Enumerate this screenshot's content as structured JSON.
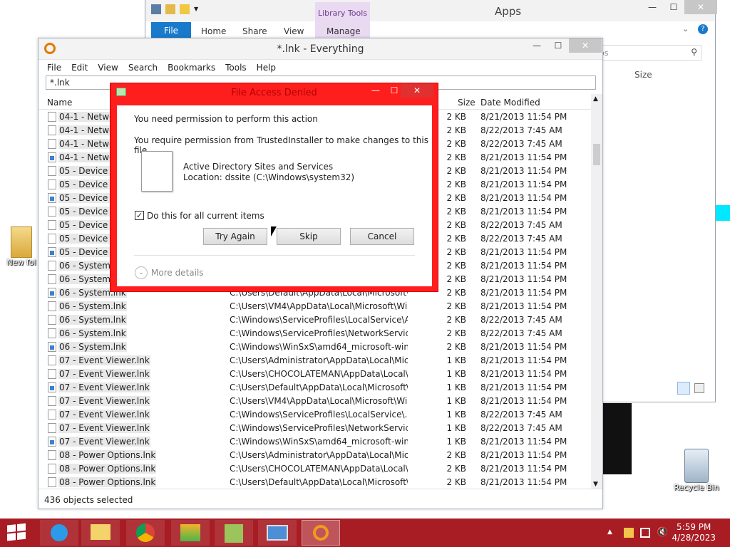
{
  "desktop": {
    "folder_label": "New fol",
    "recycle_label": "Recycle Bin"
  },
  "explorer": {
    "title": "Apps",
    "library_tools": "Library Tools",
    "tabs": [
      "File",
      "Home",
      "Share",
      "View",
      "Manage"
    ],
    "search_placeholder": "os",
    "col_size": "Size"
  },
  "everything": {
    "title": "*.lnk - Everything",
    "menu": [
      "File",
      "Edit",
      "View",
      "Search",
      "Bookmarks",
      "Tools",
      "Help"
    ],
    "search_value": "*.lnk",
    "columns": {
      "name": "Name",
      "size": "Size",
      "date": "Date Modified"
    },
    "status": "436 objects selected",
    "rows": [
      {
        "name": "04-1 - Netwo",
        "path": "",
        "size": "2 KB",
        "date": "8/21/2013 11:54 PM",
        "sc": false
      },
      {
        "name": "04-1 - Netwo",
        "path": "",
        "size": "2 KB",
        "date": "8/22/2013 7:45 AM",
        "sc": false
      },
      {
        "name": "04-1 - Netwo",
        "path": "",
        "size": "2 KB",
        "date": "8/22/2013 7:45 AM",
        "sc": false
      },
      {
        "name": "04-1 - Netwo",
        "path": "",
        "size": "2 KB",
        "date": "8/21/2013 11:54 PM",
        "sc": true
      },
      {
        "name": "05 - Device M",
        "path": "",
        "size": "2 KB",
        "date": "8/21/2013 11:54 PM",
        "sc": false
      },
      {
        "name": "05 - Device M",
        "path": "",
        "size": "2 KB",
        "date": "8/21/2013 11:54 PM",
        "sc": false
      },
      {
        "name": "05 - Device M",
        "path": "",
        "size": "2 KB",
        "date": "8/21/2013 11:54 PM",
        "sc": true
      },
      {
        "name": "05 - Device M",
        "path": "",
        "size": "2 KB",
        "date": "8/21/2013 11:54 PM",
        "sc": false
      },
      {
        "name": "05 - Device M",
        "path": "",
        "size": "2 KB",
        "date": "8/22/2013 7:45 AM",
        "sc": false
      },
      {
        "name": "05 - Device M",
        "path": "",
        "size": "2 KB",
        "date": "8/22/2013 7:45 AM",
        "sc": false
      },
      {
        "name": "05 - Device M",
        "path": "",
        "size": "2 KB",
        "date": "8/21/2013 11:54 PM",
        "sc": true
      },
      {
        "name": "06 - System.lnk",
        "path": "",
        "size": "2 KB",
        "date": "8/21/2013 11:54 PM",
        "sc": false
      },
      {
        "name": "06 - System.lnk",
        "path": "",
        "size": "2 KB",
        "date": "8/21/2013 11:54 PM",
        "sc": false
      },
      {
        "name": "06 - System.lnk",
        "path": "C:\\Users\\Default\\AppData\\Local\\Microsoft\\...",
        "size": "2 KB",
        "date": "8/21/2013 11:54 PM",
        "sc": true
      },
      {
        "name": "06 - System.lnk",
        "path": "C:\\Users\\VM4\\AppData\\Local\\Microsoft\\Win...",
        "size": "2 KB",
        "date": "8/21/2013 11:54 PM",
        "sc": false
      },
      {
        "name": "06 - System.lnk",
        "path": "C:\\Windows\\ServiceProfiles\\LocalService\\Ap...",
        "size": "2 KB",
        "date": "8/22/2013 7:45 AM",
        "sc": false
      },
      {
        "name": "06 - System.lnk",
        "path": "C:\\Windows\\ServiceProfiles\\NetworkService\\...",
        "size": "2 KB",
        "date": "8/22/2013 7:45 AM",
        "sc": false
      },
      {
        "name": "06 - System.lnk",
        "path": "C:\\Windows\\WinSxS\\amd64_microsoft-wind...",
        "size": "2 KB",
        "date": "8/21/2013 11:54 PM",
        "sc": true
      },
      {
        "name": "07 - Event Viewer.lnk",
        "path": "C:\\Users\\Administrator\\AppData\\Local\\Micr...",
        "size": "1 KB",
        "date": "8/21/2013 11:54 PM",
        "sc": false
      },
      {
        "name": "07 - Event Viewer.lnk",
        "path": "C:\\Users\\CHOCOLATEMAN\\AppData\\Local\\...",
        "size": "1 KB",
        "date": "8/21/2013 11:54 PM",
        "sc": false
      },
      {
        "name": "07 - Event Viewer.lnk",
        "path": "C:\\Users\\Default\\AppData\\Local\\Microsoft\\...",
        "size": "1 KB",
        "date": "8/21/2013 11:54 PM",
        "sc": true
      },
      {
        "name": "07 - Event Viewer.lnk",
        "path": "C:\\Users\\VM4\\AppData\\Local\\Microsoft\\Win...",
        "size": "1 KB",
        "date": "8/21/2013 11:54 PM",
        "sc": false
      },
      {
        "name": "07 - Event Viewer.lnk",
        "path": "C:\\Windows\\ServiceProfiles\\LocalService\\...",
        "size": "1 KB",
        "date": "8/22/2013 7:45 AM",
        "sc": false
      },
      {
        "name": "07 - Event Viewer.lnk",
        "path": "C:\\Windows\\ServiceProfiles\\NetworkService\\...",
        "size": "1 KB",
        "date": "8/22/2013 7:45 AM",
        "sc": false
      },
      {
        "name": "07 - Event Viewer.lnk",
        "path": "C:\\Windows\\WinSxS\\amd64_microsoft-wind...",
        "size": "1 KB",
        "date": "8/21/2013 11:54 PM",
        "sc": true
      },
      {
        "name": "08 - Power Options.lnk",
        "path": "C:\\Users\\Administrator\\AppData\\Local\\Micr...",
        "size": "2 KB",
        "date": "8/21/2013 11:54 PM",
        "sc": false
      },
      {
        "name": "08 - Power Options.lnk",
        "path": "C:\\Users\\CHOCOLATEMAN\\AppData\\Local\\...",
        "size": "2 KB",
        "date": "8/21/2013 11:54 PM",
        "sc": false
      },
      {
        "name": "08 - Power Options.lnk",
        "path": "C:\\Users\\Default\\AppData\\Local\\Microsoft\\...",
        "size": "2 KB",
        "date": "8/21/2013 11:54 PM",
        "sc": false
      }
    ]
  },
  "dialog": {
    "title": "File Access Denied",
    "heading": "You need permission to perform this action",
    "message": "You require permission from TrustedInstaller to make changes to this file",
    "file_name": "Active Directory Sites and Services",
    "file_location": "Location: dssite (C:\\Windows\\system32)",
    "checkbox_label": "Do this for all current items",
    "checkbox_checked": true,
    "try_again": "Try Again",
    "skip": "Skip",
    "cancel": "Cancel",
    "more_details": "More details"
  },
  "taskbar": {
    "time": "5:59 PM",
    "date": "4/28/2023"
  }
}
